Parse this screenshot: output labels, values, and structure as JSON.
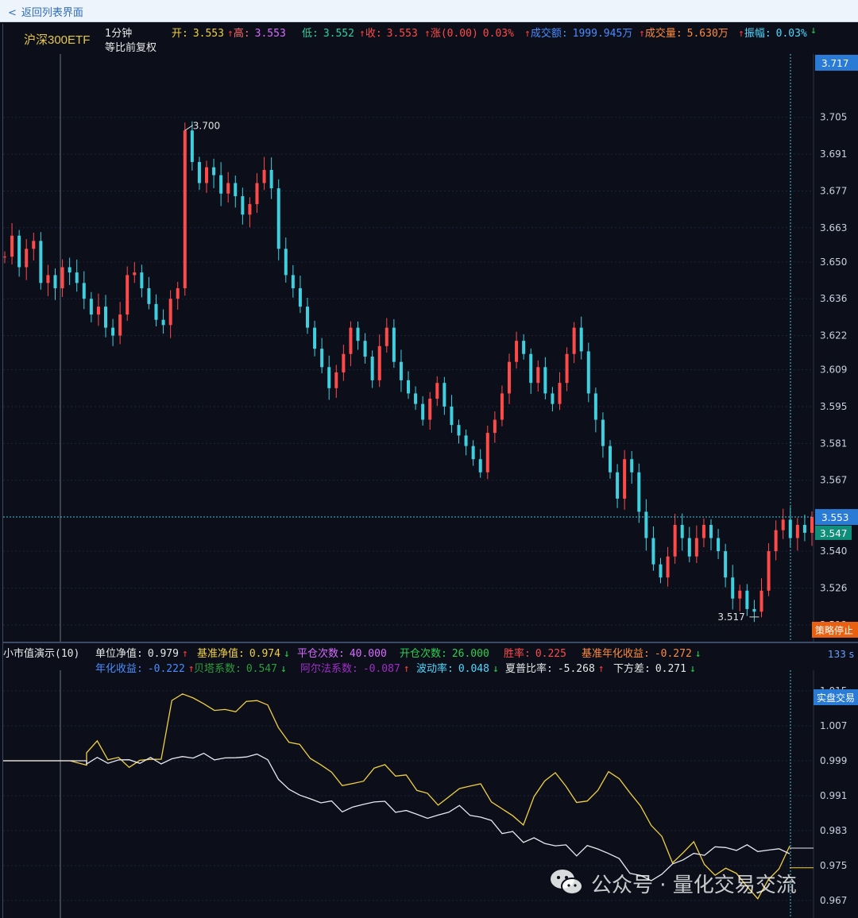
{
  "topbar": {
    "back_label": "返回列表界面"
  },
  "header": {
    "instrument": "沪深300ETF",
    "period": "1分钟",
    "adjust": "等比前复权",
    "quotes": [
      {
        "label": "开:",
        "value": "3.553",
        "label_color": "#f0d040",
        "value_color": "#f0d040",
        "arrow": ""
      },
      {
        "label": "高:",
        "value": "3.553",
        "label_color": "#ff6b6b",
        "value_color": "#d86bff",
        "arrow": "up"
      },
      {
        "label": "低:",
        "value": "3.552",
        "label_color": "#2bd1a0",
        "value_color": "#2bd1a0",
        "arrow": ""
      },
      {
        "label": "收:",
        "value": "3.553",
        "label_color": "#ff4a4a",
        "value_color": "#ff4a4a",
        "arrow": "up"
      },
      {
        "label": "涨(0.00)",
        "value": "0.03%",
        "label_color": "#ff4a4a",
        "value_color": "#ff4a4a",
        "arrow": "up"
      },
      {
        "label": "成交额:",
        "value": "1999.945万",
        "label_color": "#4a8cff",
        "value_color": "#4a8cff",
        "arrow": "up"
      },
      {
        "label": "成交量:",
        "value": "5.630万",
        "label_color": "#ff8a3a",
        "value_color": "#ff8a3a",
        "arrow": "up"
      },
      {
        "label": "振幅:",
        "value": "0.03%",
        "label_color": "#4fd8ff",
        "value_color": "#4fd8ff",
        "arrow": "up"
      }
    ],
    "end_arrow": "down"
  },
  "price_axis": {
    "labels": [
      "3.705",
      "3.691",
      "3.677",
      "3.663",
      "3.650",
      "3.636",
      "3.622",
      "3.609",
      "3.595",
      "3.581",
      "3.567",
      "3.540",
      "3.526",
      "3.512"
    ],
    "top_badge": "3.717",
    "current_badge": "3.553",
    "last_badge": "3.547",
    "max_marker": "3.700",
    "min_marker": "3.517"
  },
  "indicator": {
    "title": "小市值演示(10)",
    "row1": [
      {
        "label": "单位净值:",
        "value": "0.979",
        "color": "#e6e6e6",
        "arrow": "up"
      },
      {
        "label": "基准净值:",
        "value": "0.974",
        "color": "#f0d040",
        "arrow": "down"
      },
      {
        "label": "平仓次数:",
        "value": "40.000",
        "color": "#d86bff",
        "arrow": ""
      },
      {
        "label": "开仓次数:",
        "value": "26.000",
        "color": "#2bd151",
        "arrow": ""
      },
      {
        "label": "胜率:",
        "value": "0.225",
        "color": "#ff4a4a",
        "arrow": ""
      },
      {
        "label": "基准年化收益:",
        "value": "-0.272",
        "color": "#ff8a3a",
        "arrow": "down"
      }
    ],
    "row2": [
      {
        "label": "年化收益:",
        "value": "-0.222",
        "color": "#4a8cff",
        "arrow": "up"
      },
      {
        "label": "贝塔系数:",
        "value": "0.547",
        "color": "#2b9e3a",
        "arrow": "down"
      },
      {
        "label": "阿尔法系数:",
        "value": "-0.087",
        "color": "#a02cc9",
        "arrow": "up"
      },
      {
        "label": "波动率:",
        "value": "0.048",
        "color": "#4fd8ff",
        "arrow": "down"
      },
      {
        "label": "夏普比率:",
        "value": "-5.268",
        "color": "#e6e6e6",
        "arrow": "up"
      },
      {
        "label": "下方差:",
        "value": "0.271",
        "color": "#e6e6e6",
        "arrow": "down"
      }
    ],
    "stop_button": "策略停止",
    "timer": "133 s",
    "live_button": "实盘交易",
    "axis_labels": [
      "1.015",
      "1.007",
      "0.999",
      "0.991",
      "0.983",
      "0.975",
      "0.967"
    ]
  },
  "watermark": {
    "text": "公众号 · 量化交易交流"
  },
  "chart_data": [
    {
      "type": "candlestick",
      "title": "沪深300ETF 1分钟",
      "ylim": [
        3.505,
        3.717
      ],
      "y_ticks": [
        3.705,
        3.691,
        3.677,
        3.663,
        3.65,
        3.636,
        3.622,
        3.609,
        3.595,
        3.581,
        3.567,
        3.54,
        3.526,
        3.512
      ],
      "annotations": [
        {
          "label": "3.700",
          "value": 3.7
        },
        {
          "label": "3.517",
          "value": 3.517
        }
      ],
      "series": [
        {
          "values": [
            3.652,
            3.66,
            3.648,
            3.655,
            3.658,
            3.642,
            3.645,
            3.64,
            3.648,
            3.646,
            3.642,
            3.636,
            3.63,
            3.633,
            3.625,
            3.622,
            3.63,
            3.645,
            3.646,
            3.64,
            3.634,
            3.628,
            3.626,
            3.636,
            3.64,
            3.7,
            3.688,
            3.68,
            3.686,
            3.683,
            3.676,
            3.68,
            3.675,
            3.668,
            3.672,
            3.68,
            3.685,
            3.678,
            3.655,
            3.645,
            3.64,
            3.633,
            3.625,
            3.617,
            3.61,
            3.602,
            3.608,
            3.615,
            3.625,
            3.62,
            3.614,
            3.605,
            3.618,
            3.625,
            3.612,
            3.605,
            3.6,
            3.596,
            3.59,
            3.598,
            3.604,
            3.595,
            3.588,
            3.584,
            3.58,
            3.575,
            3.57,
            3.585,
            3.59,
            3.6,
            3.612,
            3.62,
            3.615,
            3.604,
            3.61,
            3.6,
            3.596,
            3.604,
            3.615,
            3.625,
            3.616,
            3.6,
            3.59,
            3.58,
            3.57,
            3.56,
            3.575,
            3.57,
            3.555,
            3.545,
            3.535,
            3.53,
            3.538,
            3.55,
            3.545,
            3.538,
            3.545,
            3.55,
            3.545,
            3.54,
            3.53,
            3.522,
            3.525,
            3.518,
            3.517,
            3.525,
            3.54,
            3.548,
            3.552,
            3.545,
            3.55,
            3.547,
            3.553
          ]
        }
      ]
    },
    {
      "type": "line",
      "title": "小市值演示(10)",
      "ylim": [
        0.963,
        1.019
      ],
      "y_ticks": [
        1.015,
        1.007,
        0.999,
        0.991,
        0.983,
        0.975,
        0.967
      ],
      "series": [
        {
          "name": "单位净值",
          "color": "#f0d040",
          "values": [
            0.999,
            0.999,
            0.999,
            0.999,
            0.999,
            0.998,
            1.001,
            1.003,
            1.0,
            0.999,
            0.998,
            0.999,
            0.999,
            1.0,
            1.012,
            1.015,
            1.013,
            1.012,
            1.011,
            1.01,
            1.011,
            1.012,
            1.013,
            1.012,
            1.006,
            1.004,
            1.002,
            1.0,
            0.998,
            0.996,
            0.994,
            0.993,
            0.995,
            0.997,
            0.998,
            0.996,
            0.995,
            0.993,
            0.991,
            0.989,
            0.991,
            0.992,
            0.994,
            0.993,
            0.99,
            0.988,
            0.986,
            0.985,
            0.99,
            0.995,
            0.996,
            0.993,
            0.99,
            0.989,
            0.993,
            0.996,
            0.995,
            0.992,
            0.988,
            0.985,
            0.981,
            0.976,
            0.978,
            0.98,
            0.976,
            0.972,
            0.975,
            0.973,
            0.97,
            0.968,
            0.971,
            0.975,
            0.979
          ]
        },
        {
          "name": "基准净值",
          "color": "#e8e8f0",
          "values": [
            0.999,
            0.999,
            0.999,
            0.999,
            0.999,
            0.999,
            0.999,
            0.999,
            0.999,
            0.999,
            0.999,
            0.999,
            0.999,
            0.999,
            0.999,
            1.0,
            1.0,
            1.0,
            1.0,
            0.999,
            1.0,
            1.0,
            1.0,
            1.0,
            0.994,
            0.993,
            0.991,
            0.99,
            0.99,
            0.989,
            0.988,
            0.988,
            0.989,
            0.99,
            0.989,
            0.988,
            0.987,
            0.987,
            0.986,
            0.986,
            0.988,
            0.988,
            0.987,
            0.986,
            0.985,
            0.983,
            0.982,
            0.981,
            0.981,
            0.98,
            0.98,
            0.979,
            0.978,
            0.979,
            0.979,
            0.978,
            0.976,
            0.974,
            0.972,
            0.972,
            0.973,
            0.975,
            0.977,
            0.977,
            0.978,
            0.979,
            0.979,
            0.979,
            0.979,
            0.979,
            0.978,
            0.979,
            0.978
          ]
        }
      ]
    }
  ]
}
